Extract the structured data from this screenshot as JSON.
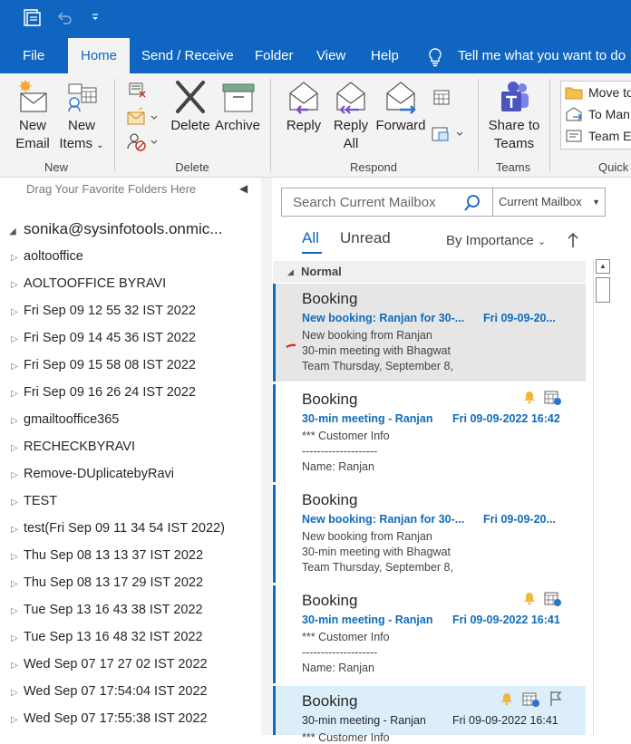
{
  "tabs": {
    "file": "File",
    "home": "Home",
    "send_receive": "Send / Receive",
    "folder": "Folder",
    "view": "View",
    "help": "Help",
    "tell_me": "Tell me what you want to do"
  },
  "ribbon": {
    "new_email": [
      "New",
      "Email"
    ],
    "new_items": [
      "New",
      "Items"
    ],
    "delete": "Delete",
    "archive": "Archive",
    "reply": "Reply",
    "reply_all": [
      "Reply",
      "All"
    ],
    "forward": "Forward",
    "share_teams": [
      "Share to",
      "Teams"
    ],
    "move_to": "Move to",
    "to_manager": "To Man",
    "team_email": "Team E",
    "groups": {
      "new": "New",
      "delete": "Delete",
      "respond": "Respond",
      "teams": "Teams",
      "quick": "Quick"
    }
  },
  "folder_pane": {
    "favorites_hint": "Drag Your Favorite Folders Here",
    "account": "sonika@sysinfotools.onmic...",
    "folders": [
      "aoltooffice",
      "AOLTOOFFICE BYRAVI",
      "Fri Sep 09 12 55 32 IST 2022",
      "Fri Sep 09 14 45 36 IST 2022",
      "Fri Sep 09 15 58 08 IST 2022",
      "Fri Sep 09 16 26 24 IST 2022",
      "gmailtooffice365",
      "RECHECKBYRAVI",
      "Remove-DUplicatebyRavi",
      "TEST",
      "test(Fri Sep 09 11 34 54 IST 2022)",
      "Thu Sep 08 13 13 37 IST 2022",
      "Thu Sep 08 13 17 29 IST 2022",
      "Tue Sep 13 16 43 38 IST 2022",
      "Tue Sep 13 16 48 32 IST 2022",
      "Wed Sep 07 17 27 02 IST 2022",
      "Wed Sep 07 17:54:04 IST 2022",
      "Wed Sep 07 17:55:38 IST 2022"
    ]
  },
  "message_list": {
    "search_placeholder": "Search Current Mailbox",
    "scope": "Current Mailbox",
    "filter_all": "All",
    "filter_unread": "Unread",
    "sort": "By Importance",
    "group_header": "Normal",
    "messages": [
      {
        "from": "Booking",
        "subject": "New booking: Ranjan for 30-...",
        "date": "Fri 09-09-20...",
        "line1": "New booking from  Ranjan",
        "line2": "30-min meeting with  Bhagwat",
        "line3": "Team   Thursday, September 8,"
      },
      {
        "from": "Booking",
        "subject": "30-min meeting - Ranjan",
        "date": "Fri 09-09-2022 16:42",
        "line1": "***  Customer Info",
        "line2": "--------------------",
        "line3": "Name: Ranjan"
      },
      {
        "from": "Booking",
        "subject": "New booking: Ranjan for 30-...",
        "date": "Fri 09-09-20...",
        "line1": "New booking from  Ranjan",
        "line2": "30-min meeting with  Bhagwat",
        "line3": "Team   Thursday, September 8,"
      },
      {
        "from": "Booking",
        "subject": "30-min meeting - Ranjan",
        "date": "Fri 09-09-2022 16:41",
        "line1": "***  Customer Info",
        "line2": "--------------------",
        "line3": "Name: Ranjan"
      },
      {
        "from": "Booking",
        "subject": "30-min meeting - Ranjan",
        "date": "Fri 09-09-2022 16:41",
        "line1": "***  Customer Info",
        "line2": "",
        "line3": ""
      }
    ]
  }
}
